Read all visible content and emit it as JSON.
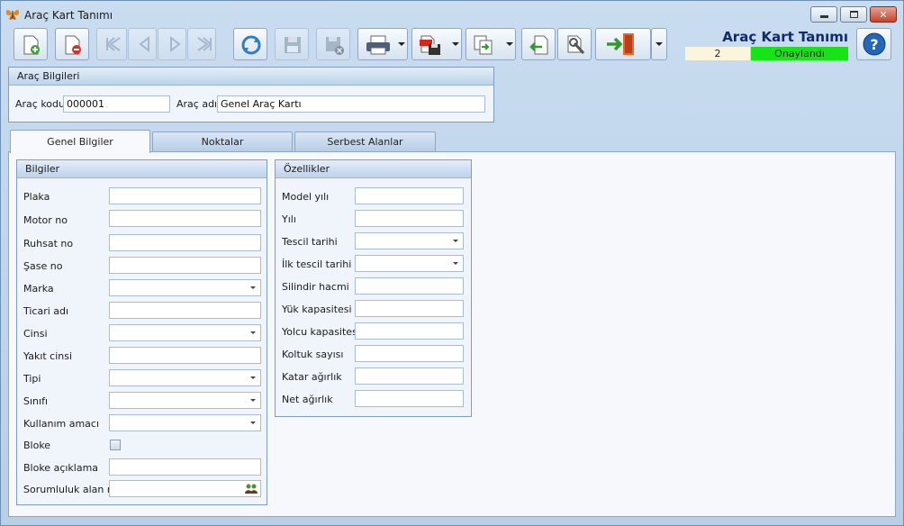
{
  "window": {
    "title": "Araç Kart Tanımı",
    "header_title": "Araç Kart Tanımı",
    "record_number": "2",
    "status": "Onaylandı",
    "status_color": "#16e416"
  },
  "toolbar": {
    "icons": [
      "new-document-icon",
      "delete-document-icon",
      "first-record-icon",
      "previous-record-icon",
      "next-record-icon",
      "last-record-icon",
      "refresh-icon",
      "save-icon",
      "save-cancel-icon",
      "print-icon",
      "pdf-export-icon",
      "copy-icon",
      "import-icon",
      "settings-icon",
      "exit-door-icon",
      "help-icon"
    ]
  },
  "vehicle_info": {
    "title": "Araç Bilgileri",
    "code_label": "Araç kodu",
    "code_value": "000001",
    "name_label": "Araç adı",
    "name_value": "Genel Araç Kartı"
  },
  "tabs": [
    {
      "label": "Genel Bilgiler"
    },
    {
      "label": "Noktalar"
    },
    {
      "label": "Serbest Alanlar"
    }
  ],
  "bilgiler": {
    "title": "Bilgiler",
    "fields": [
      {
        "label": "Plaka",
        "value": ""
      },
      {
        "label": "Motor no",
        "value": ""
      },
      {
        "label": "Ruhsat no",
        "value": ""
      },
      {
        "label": "Şase no",
        "value": ""
      },
      {
        "label": "Marka",
        "value": ""
      },
      {
        "label": "Ticari adı",
        "value": ""
      },
      {
        "label": "Cinsi",
        "value": ""
      },
      {
        "label": "Yakıt cinsi",
        "value": ""
      },
      {
        "label": "Tipi",
        "value": ""
      },
      {
        "label": "Sınıfı",
        "value": ""
      },
      {
        "label": "Kullanım amacı",
        "value": ""
      },
      {
        "label": "Bloke",
        "value": ""
      },
      {
        "label": "Bloke açıklama",
        "value": ""
      },
      {
        "label": "Sorumluluk alan no",
        "value": ""
      }
    ]
  },
  "ozellikler": {
    "title": "Özellikler",
    "fields": [
      {
        "label": "Model yılı",
        "value": ""
      },
      {
        "label": "Yılı",
        "value": ""
      },
      {
        "label": "Tescil tarihi",
        "value": ""
      },
      {
        "label": "İlk tescil tarihi",
        "value": ""
      },
      {
        "label": "Silindir hacmi",
        "value": ""
      },
      {
        "label": "Yük kapasitesi",
        "value": ""
      },
      {
        "label": "Yolcu kapasitesi",
        "value": ""
      },
      {
        "label": "Koltuk sayısı",
        "value": ""
      },
      {
        "label": "Katar ağırlık",
        "value": ""
      },
      {
        "label": "Net ağırlık",
        "value": ""
      }
    ]
  }
}
